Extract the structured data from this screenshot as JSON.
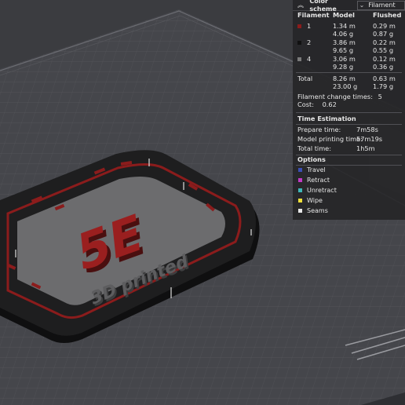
{
  "panel": {
    "collapse_icon": "chevron-up-double",
    "color_scheme_label": "Color scheme",
    "color_scheme_value": "Filament",
    "filament_table": {
      "headers": [
        "Filament",
        "Model",
        "Flushed"
      ],
      "rows": [
        {
          "id": "1",
          "color": "#8b1c1c",
          "model_m": "1.34 m",
          "model_g": "4.06 g",
          "flushed_m": "0.29 m",
          "flushed_g": "0.87 g"
        },
        {
          "id": "2",
          "color": "#111111",
          "model_m": "3.86 m",
          "model_g": "9.65 g",
          "flushed_m": "0.22 m",
          "flushed_g": "0.55 g"
        },
        {
          "id": "4",
          "color": "#7a7a7a",
          "model_m": "3.06 m",
          "model_g": "9.28 g",
          "flushed_m": "0.12 m",
          "flushed_g": "0.36 g"
        }
      ],
      "total_label": "Total",
      "total_model_m": "8.26 m",
      "total_model_g": "23.00 g",
      "total_flushed_m": "0.63 m",
      "total_flushed_g": "1.79 g"
    },
    "change_times_label": "Filament change times:",
    "change_times_value": "5",
    "cost_label": "Cost:",
    "cost_value": "0.62",
    "time_section": "Time Estimation",
    "prepare_label": "Prepare time:",
    "prepare_value": "7m58s",
    "model_print_label": "Model printing time:",
    "model_print_value": "57m19s",
    "total_time_label": "Total time:",
    "total_time_value": "1h5m",
    "options_section": "Options",
    "options": [
      {
        "label": "Travel",
        "color": "#3b4fb5"
      },
      {
        "label": "Retract",
        "color": "#c23bc6"
      },
      {
        "label": "Unretract",
        "color": "#3fb7b8"
      },
      {
        "label": "Wipe",
        "color": "#f0e03a"
      },
      {
        "label": "Seams",
        "color": "#e8e8e8"
      }
    ]
  },
  "model": {
    "big_text": "5E",
    "sub_text": "3D printed",
    "colors": {
      "red": "#8b1c1c",
      "black": "#141414",
      "gray": "#6e6e6e",
      "plate": "#3c3d41"
    }
  }
}
